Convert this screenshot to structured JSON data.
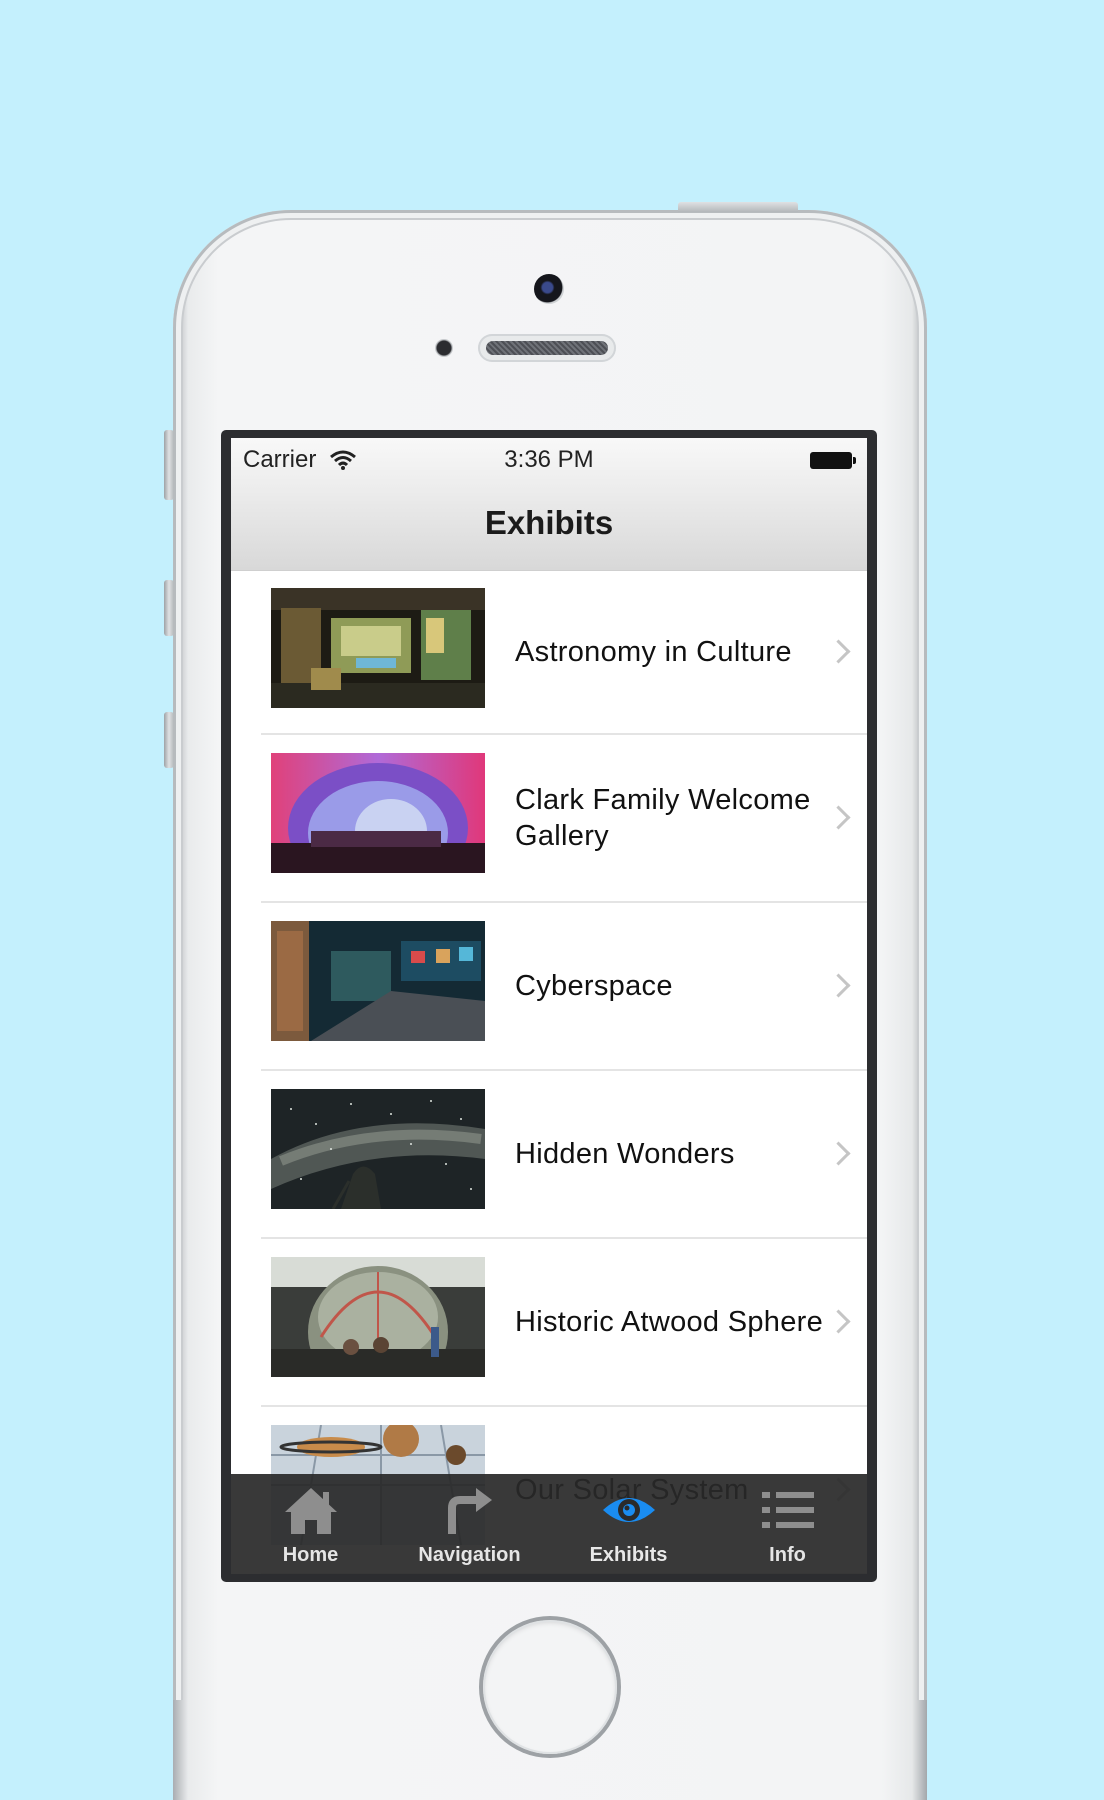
{
  "status_bar": {
    "carrier": "Carrier",
    "time": "3:36 PM"
  },
  "nav": {
    "title": "Exhibits"
  },
  "exhibits": [
    {
      "label": "Astronomy in Culture",
      "thumbnail": "museum-gallery-photo"
    },
    {
      "label": "Clark Family Welcome Gallery",
      "thumbnail": "purple-dome-photo"
    },
    {
      "label": "Cyberspace",
      "thumbnail": "exhibit-hall-photo"
    },
    {
      "label": "Hidden Wonders",
      "thumbnail": "milky-way-photo"
    },
    {
      "label": "Historic Atwood Sphere",
      "thumbnail": "atwood-sphere-photo"
    },
    {
      "label": "Our Solar System",
      "thumbnail": "solar-system-photo"
    }
  ],
  "tabbar": {
    "tabs": [
      {
        "label": "Home",
        "icon": "home-icon"
      },
      {
        "label": "Navigation",
        "icon": "turn-arrow-icon"
      },
      {
        "label": "Exhibits",
        "icon": "eye-icon"
      },
      {
        "label": "Info",
        "icon": "list-icon"
      }
    ],
    "active_color": "#1a8cf0",
    "inactive_color": "#8e8e8e"
  },
  "background_color": "#c4f0fd"
}
